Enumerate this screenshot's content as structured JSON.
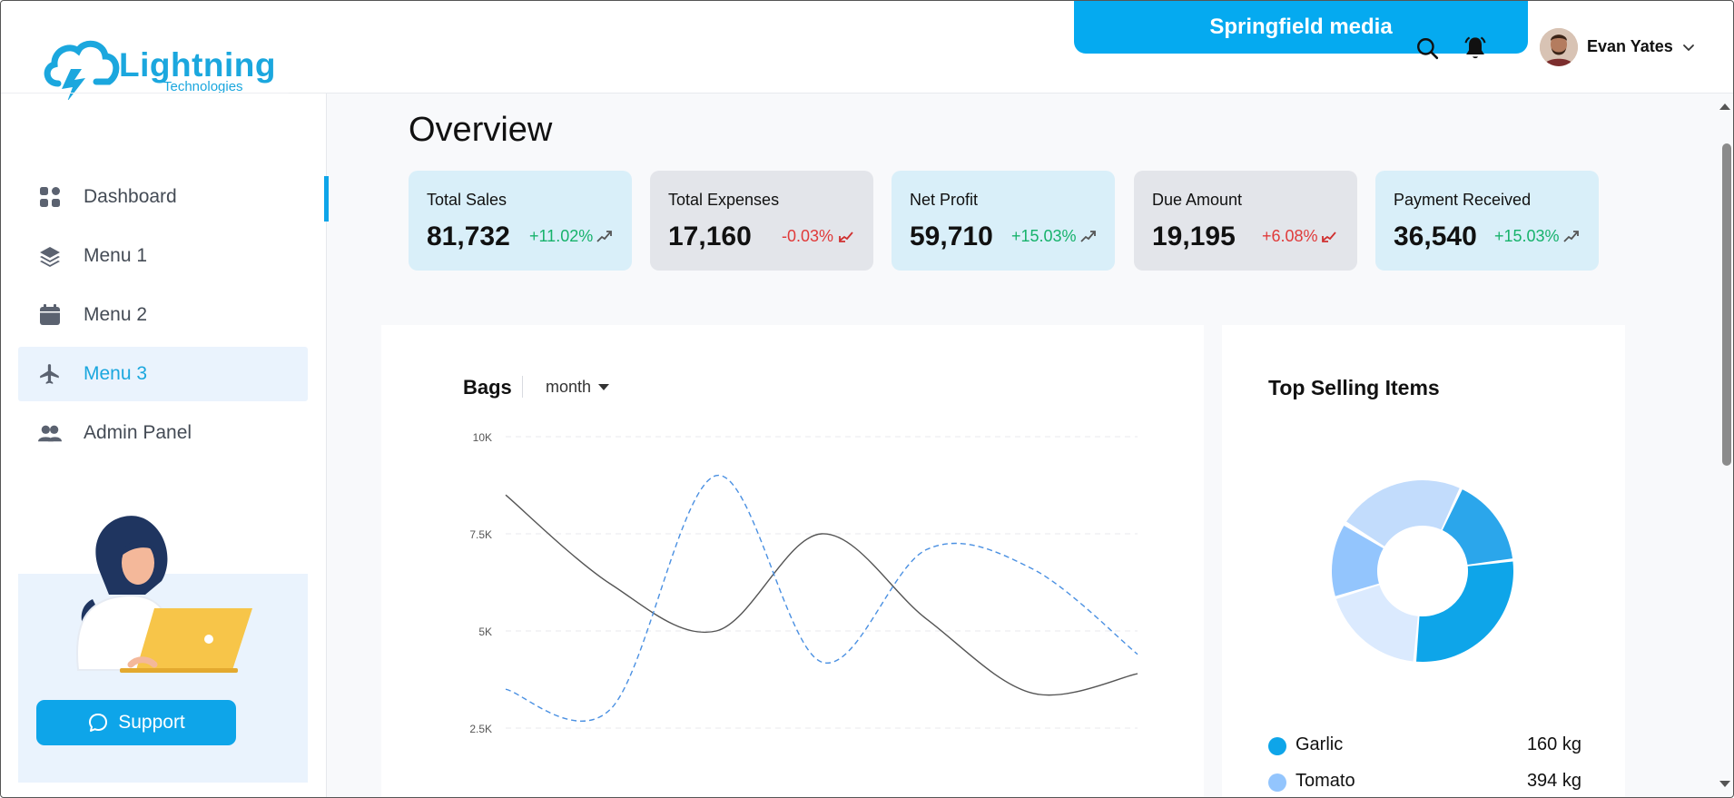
{
  "brand": {
    "logo_name": "Lightning",
    "logo_sub": "Technologies",
    "accent": "#0ea5e9"
  },
  "header": {
    "workspace": "Springfield media",
    "user_name": "Evan Yates",
    "icons": [
      "search-icon",
      "bell-icon",
      "chevron-down-icon"
    ]
  },
  "sidebar": {
    "items": [
      {
        "label": "Dashboard",
        "icon": "dashboard-grid-icon",
        "active": false
      },
      {
        "label": "Menu 1",
        "icon": "layers-icon",
        "active": false
      },
      {
        "label": "Menu 2",
        "icon": "calendar-icon",
        "active": false
      },
      {
        "label": "Menu 3",
        "icon": "airplane-icon",
        "active": true
      },
      {
        "label": "Admin Panel",
        "icon": "users-icon",
        "active": false
      }
    ],
    "support_label": "Support"
  },
  "main": {
    "title": "Overview",
    "stats": [
      {
        "label": "Total Sales",
        "value": "81,732",
        "change": "+11.02%",
        "direction": "up"
      },
      {
        "label": "Total Expenses",
        "value": "17,160",
        "change": "-0.03%",
        "direction": "down"
      },
      {
        "label": "Net Profit",
        "value": "59,710",
        "change": "+15.03%",
        "direction": "up"
      },
      {
        "label": "Due Amount",
        "value": "19,195",
        "change": "+6.08%",
        "direction": "down"
      },
      {
        "label": "Payment Received",
        "value": "36,540",
        "change": "+15.03%",
        "direction": "up"
      }
    ],
    "line_chart": {
      "title": "Bags",
      "filter": "month"
    },
    "top_selling": {
      "title": "Top Selling Items"
    }
  },
  "chart_data": [
    {
      "type": "line",
      "title": "Bags",
      "y_ticks": [
        "10K",
        "7.5K",
        "5K",
        "2.5K"
      ],
      "ylim": [
        2500,
        10000
      ],
      "grid": true,
      "series": [
        {
          "style": "solid",
          "color": "#555555",
          "values": [
            8500,
            6200,
            5000,
            7500,
            5300,
            3400,
            3900
          ]
        },
        {
          "style": "dashed",
          "color": "#4a90e2",
          "values": [
            3500,
            3000,
            9000,
            4200,
            7100,
            6600,
            4400
          ]
        }
      ]
    },
    {
      "type": "pie",
      "title": "Top Selling Items",
      "donut": true,
      "slices": [
        {
          "name": "Garlic",
          "value": 160,
          "unit": "kg",
          "color": "#0ea5e9"
        },
        {
          "name": "Tomato",
          "value": 394,
          "unit": "kg",
          "color": "#93c5fd"
        },
        {
          "color": "#c2dcfc"
        },
        {
          "color": "#dbeafe"
        },
        {
          "color": "#2ba6eb"
        }
      ],
      "legend_placement": "bottom"
    }
  ]
}
